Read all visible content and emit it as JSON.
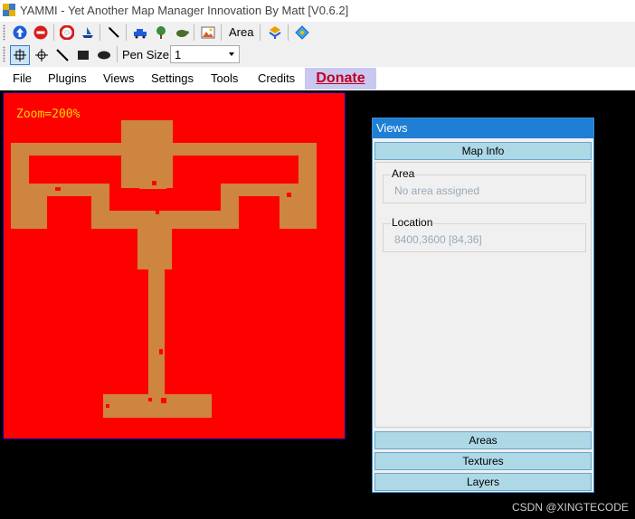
{
  "window": {
    "title": "YAMMI - Yet Another Map Manager Innovation By Matt [V0.6.2]"
  },
  "toolbar1": {
    "icons": [
      "arrow-up-icon",
      "stop-icon",
      "lifebuoy-icon",
      "ship-icon",
      "pen-icon",
      "car-icon",
      "tree-icon",
      "turtle-icon",
      "picture-icon",
      "layers-icon",
      "diamond-icon"
    ],
    "area_label": "Area"
  },
  "toolbar2": {
    "pen_size_label": "Pen Size",
    "pen_size_value": "1"
  },
  "menu": {
    "file": "File",
    "plugins": "Plugins",
    "views": "Views",
    "settings": "Settings",
    "tools": "Tools",
    "credits": "Credits",
    "donate": "Donate"
  },
  "map": {
    "zoom_text": "Zoom=200%",
    "background_color": "#ff0000",
    "walkable_color": "#cd853f"
  },
  "views_panel": {
    "title": "Views",
    "map_info_button": "Map Info",
    "area_legend": "Area",
    "area_value": "No area assigned",
    "location_legend": "Location",
    "location_value": "8400,3600 [84,36]",
    "areas_button": "Areas",
    "textures_button": "Textures",
    "layers_button": "Layers"
  },
  "watermark": "CSDN @XINGTECODE"
}
